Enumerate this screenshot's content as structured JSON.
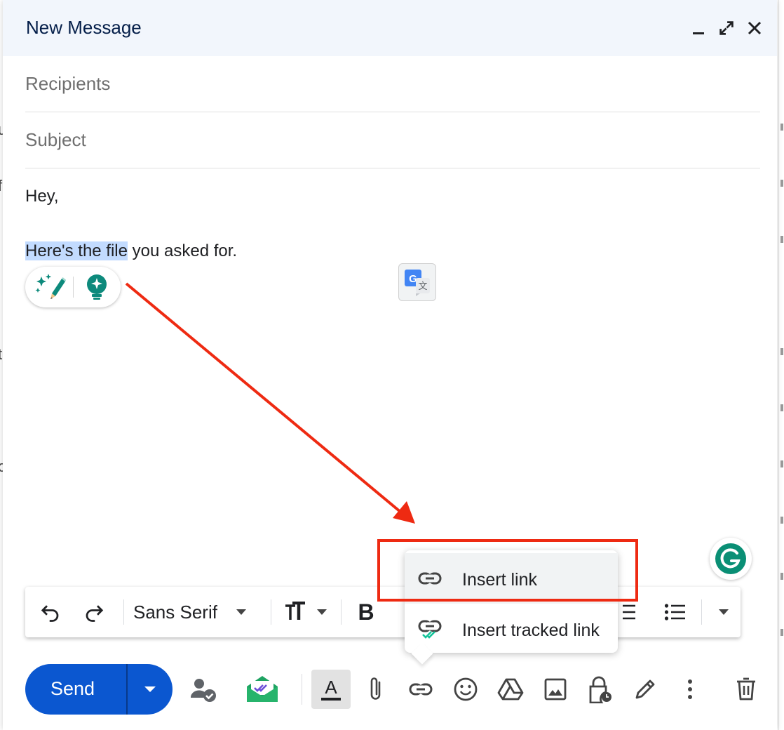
{
  "compose": {
    "title": "New Message",
    "recipients_placeholder": "Recipients",
    "subject_placeholder": "Subject",
    "body": {
      "line1": "Hey,",
      "line2_highlighted": "Here's the file",
      "line2_rest": " you asked for."
    }
  },
  "format_toolbar": {
    "font": "Sans Serif",
    "bold_label": "B"
  },
  "link_menu": {
    "items": [
      {
        "label": "Insert link"
      },
      {
        "label": "Insert tracked link"
      }
    ]
  },
  "bottom_bar": {
    "send_label": "Send"
  },
  "colors": {
    "send_blue": "#0b57d0",
    "header_bg": "#f2f6fc",
    "annotation_red": "#ee2a12",
    "selection": "#c2dbff",
    "grammarly_green": "#15c39a"
  }
}
